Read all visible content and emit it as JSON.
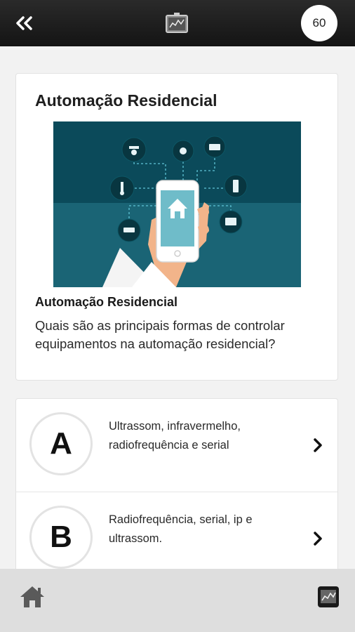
{
  "header": {
    "back_icon": "double-chevron-left-icon",
    "logo_icon": "chalkboard-logo-icon",
    "timer_value": "60"
  },
  "question": {
    "title": "Automação Residencial",
    "image_icon": "home-automation-illustration",
    "subtitle": "Automação Residencial",
    "text": "Quais são as principais formas de controlar equipamentos na automação residencial?"
  },
  "answers": [
    {
      "letter": "A",
      "text": "Ultrassom, infravermelho, radiofrequência e serial"
    },
    {
      "letter": "B",
      "text": "Radiofrequência, serial, ip e ultrassom."
    }
  ],
  "footer": {
    "home_icon": "home-icon",
    "menu_icon": "chalkboard-icon"
  },
  "colors": {
    "topbar": "#1c1c1c",
    "image_bg_dark": "#0b4a5a",
    "image_bg_light": "#1a6475",
    "bottombar": "#dedede"
  }
}
